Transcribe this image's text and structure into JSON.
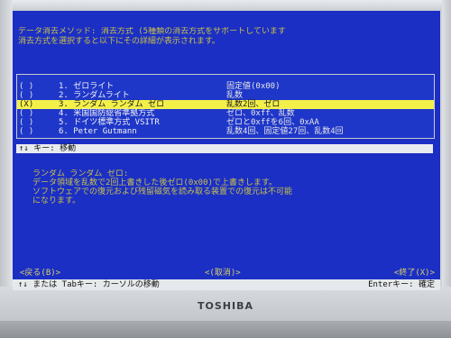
{
  "header": {
    "line1": "データ消去メソッド: 消去方式 (5種類の消去方式をサポートしています",
    "line2": "消去方式を選択すると以下にその詳細が表示されます。"
  },
  "methods": [
    {
      "radio": "( )",
      "name": "1. ゼロライト",
      "desc": "固定値(0x00)",
      "selected": false
    },
    {
      "radio": "( )",
      "name": "2. ランダムライト",
      "desc": "乱数",
      "selected": false
    },
    {
      "radio": "(X)",
      "name": "3. ランダム ランダム ゼロ",
      "desc": "乱数2回、ゼロ",
      "selected": true
    },
    {
      "radio": "( )",
      "name": "4. 米国国防総省準拠方式",
      "desc": "ゼロ、0xff、乱数",
      "selected": false
    },
    {
      "radio": "( )",
      "name": "5. ドイツ標準方式 VSITR",
      "desc": "ゼロと0xffを6回、0xAA",
      "selected": false
    },
    {
      "radio": "( )",
      "name": "6. Peter Gutmann",
      "desc": "乱数4回、固定値27回、乱数4回",
      "selected": false
    }
  ],
  "hint_bar": "↑↓ キー: 移動",
  "description": {
    "title": "ランダム ランダム ゼロ:",
    "line1": "データ領域を乱数で2回上書きした後ゼロ(0x00)で上書きします。",
    "line2": "ソフトウェアでの復元および残留磁気を読み取る装置での復元は不可能",
    "line3": "になります。"
  },
  "buttons": {
    "back": "<戻る(B)>",
    "cancel": "<(取消)>",
    "finish": "<終了(X)>"
  },
  "footer": {
    "left": "↑↓ または Tabキー: カーソルの移動",
    "right": "Enterキー: 確定"
  },
  "brand": "TOSHIBA"
}
